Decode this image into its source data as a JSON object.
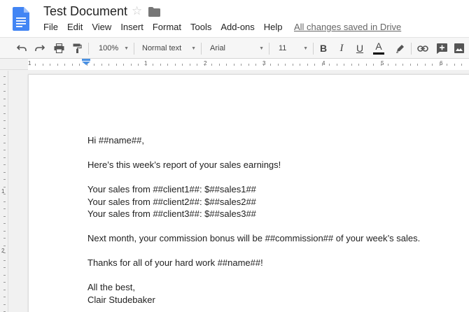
{
  "header": {
    "title": "Test Document",
    "saved_status": "All changes saved in Drive"
  },
  "menu": [
    "File",
    "Edit",
    "View",
    "Insert",
    "Format",
    "Tools",
    "Add-ons",
    "Help"
  ],
  "toolbar": {
    "zoom": "100%",
    "style": "Normal text",
    "font": "Arial",
    "font_size": "11",
    "bold": "B",
    "italic": "I",
    "underline": "U",
    "text_color": "A"
  },
  "ruler_numbers": [
    "1",
    "1",
    "2",
    "3",
    "4",
    "5",
    "6"
  ],
  "vruler_numbers": [
    "1",
    "2"
  ],
  "document": {
    "lines": [
      "Hi ##name##,",
      "",
      "Here’s this week’s report of your sales earnings!",
      "",
      "Your sales from ##client1##: $##sales1##",
      "Your sales from ##client2##: $##sales2##",
      "Your sales from ##client3##: $##sales3##",
      "",
      "Next month, your commission bonus will be ##commission## of your week’s sales.",
      "",
      "Thanks for all of your hard work ##name##!",
      "",
      "All the best,",
      "Clair Studebaker"
    ]
  },
  "colors": {
    "docs_blue": "#4285f4",
    "ruler_indent": "#4a90e2"
  }
}
